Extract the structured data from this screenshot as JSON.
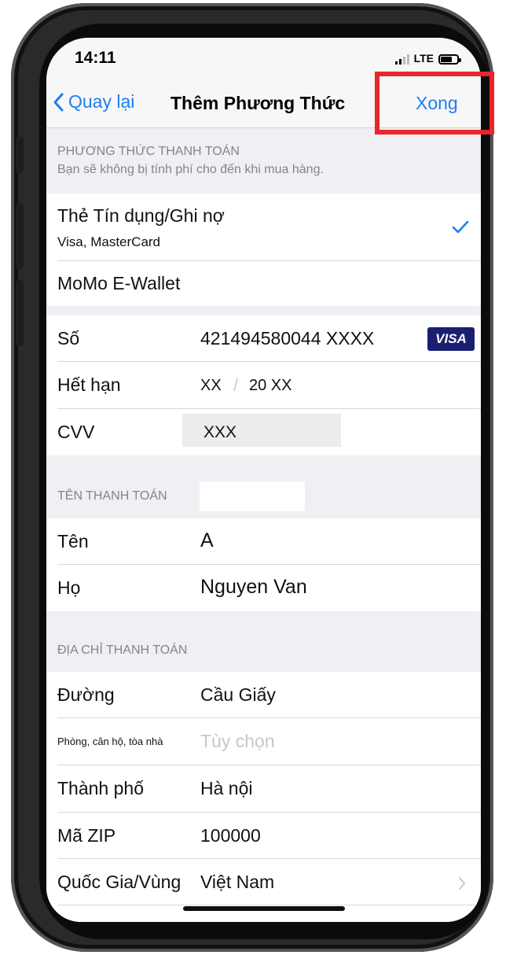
{
  "status_bar": {
    "time": "14:11",
    "network": "LTE"
  },
  "nav": {
    "back_label": "Quay lại",
    "title": "Thêm Phương Thức",
    "done_label": "Xong"
  },
  "payment_method": {
    "header": "PHƯƠNG THỨC THANH TOÁN",
    "subheader": "Bạn sẽ không bị tính phí cho đến khi mua hàng.",
    "options": [
      {
        "title": "Thẻ Tín dụng/Ghi nợ",
        "subtitle": "Visa, MasterCard",
        "selected": true
      },
      {
        "title": "MoMo E-Wallet",
        "selected": false
      }
    ]
  },
  "card": {
    "number_label": "Số",
    "number_value": "421494580044 XXXX",
    "brand": "VISA",
    "expiry_label": "Hết hạn",
    "expiry_month": "XX",
    "expiry_sep": "/",
    "expiry_year": "20 XX",
    "cvv_label": "CVV",
    "cvv_value": "XXX"
  },
  "billing_name": {
    "header": "TÊN THANH TOÁN",
    "first_label": "Tên",
    "first_value": "A",
    "last_label": "Họ",
    "last_value": "Nguyen Van"
  },
  "billing_address": {
    "header": "ĐỊA CHỈ THANH TOÁN",
    "street_label": "Đường",
    "street_value": "Cầu Giấy",
    "apt_label": "Phòng, căn hộ, tòa nhà",
    "apt_placeholder": "Tùy chọn",
    "city_label": "Thành phố",
    "city_value": "Hà nội",
    "zip_label": "Mã ZIP",
    "zip_value": "100000",
    "country_label": "Quốc Gia/Vùng",
    "country_value": "Việt Nam"
  },
  "colors": {
    "accent": "#1a7ef2",
    "highlight_box": "#e9262c",
    "visa_badge": "#1a1f71"
  }
}
